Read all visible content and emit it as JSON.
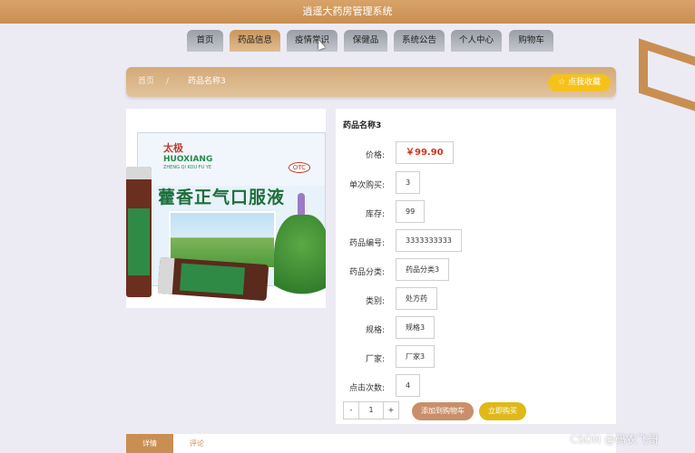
{
  "header": {
    "title": "逍遥大药房管理系统"
  },
  "nav": {
    "items": [
      {
        "label": "首页"
      },
      {
        "label": "药品信息"
      },
      {
        "label": "疫情常识"
      },
      {
        "label": "保健品"
      },
      {
        "label": "系统公告"
      },
      {
        "label": "个人中心"
      },
      {
        "label": "购物车"
      }
    ],
    "active_index": 1
  },
  "breadcrumb": {
    "home": "首页",
    "separator": "/",
    "current": "药品名称3",
    "favorite_label": "☆ 点我收藏"
  },
  "product_image": {
    "brand": "太极",
    "name_latin": "HUOXIANG",
    "name_pinyin": "ZHENG QI KOU FU YE",
    "otc": "OTC",
    "box_title": "藿香正气口服液"
  },
  "product": {
    "name": "药品名称3",
    "fields": [
      {
        "label": "价格:",
        "value": "￥99.90",
        "kind": "price"
      },
      {
        "label": "单次购买:",
        "value": "3"
      },
      {
        "label": "库存:",
        "value": "99"
      },
      {
        "label": "药品编号:",
        "value": "3333333333"
      },
      {
        "label": "药品分类:",
        "value": "药品分类3"
      },
      {
        "label": "类别:",
        "value": "处方药"
      },
      {
        "label": "规格:",
        "value": "规格3"
      },
      {
        "label": "厂家:",
        "value": "厂家3"
      },
      {
        "label": "点击次数:",
        "value": "4"
      }
    ]
  },
  "purchase": {
    "minus": "-",
    "quantity": "1",
    "plus": "+",
    "add_to_cart": "添加到购物车",
    "buy_now": "立即购买"
  },
  "tabs": [
    {
      "label": "详情"
    },
    {
      "label": "评论"
    }
  ],
  "watermark": "CSDN @码农飞哥",
  "colors": {
    "accent": "#c98f52",
    "favorite": "#f5c21b",
    "price": "#d8321e",
    "cart_button": "#c98e6a",
    "buy_button": "#e0b916"
  }
}
